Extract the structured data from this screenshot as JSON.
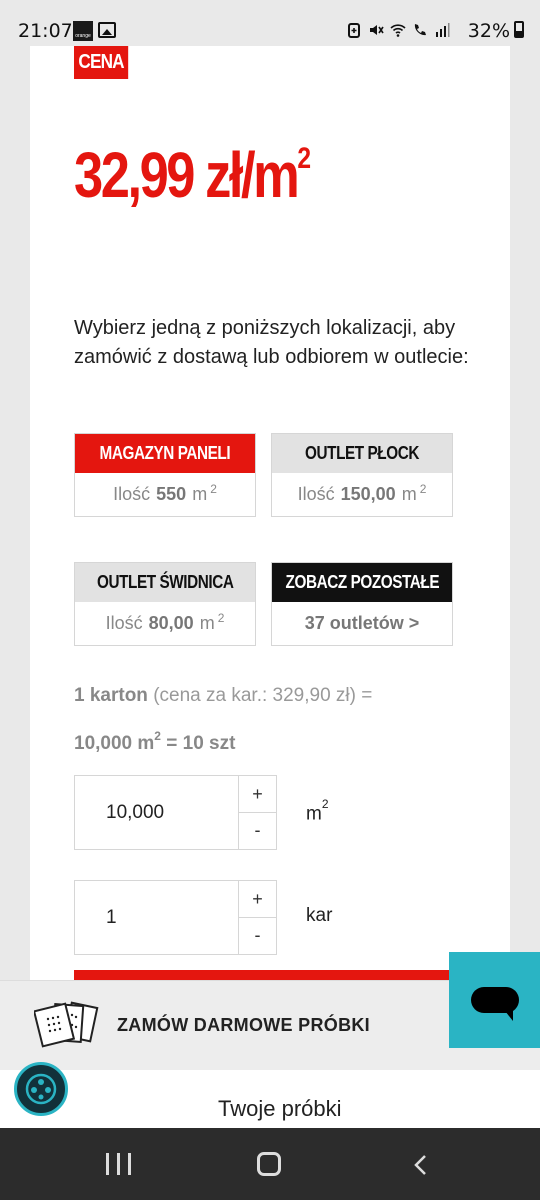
{
  "status_bar": {
    "time": "21:07",
    "carrier_logo": "orange",
    "battery": "32%",
    "icons": [
      "gallery-icon",
      "battery-saver-icon",
      "mute-icon",
      "wifi-icon",
      "wifi-call-icon",
      "signal-icon"
    ]
  },
  "product": {
    "price_badge": "CENA",
    "price": "32,99 zł/m",
    "price_sup": "2"
  },
  "location_intro": "Wybierz jedną z poniższych lokalizacji, aby zamówić z dostawą lub odbiorem w outlecie:",
  "locations": [
    {
      "name": "MAGAZYN PANELI",
      "qty_label": "Ilość",
      "qty": "550",
      "unit": "m",
      "unit_sup": "2",
      "selected": true
    },
    {
      "name": "OUTLET PŁOCK",
      "qty_label": "Ilość",
      "qty": "150,00",
      "unit": "m",
      "unit_sup": "2",
      "selected": false
    },
    {
      "name": "OUTLET ŚWIDNICA",
      "qty_label": "Ilość",
      "qty": "80,00",
      "unit": "m",
      "unit_sup": "2",
      "selected": false
    },
    {
      "name": "ZOBACZ POZOSTAŁE",
      "link": "37 outletów >"
    }
  ],
  "karton": {
    "count": "1 karton",
    "price_note": " (cena za kar.: 329,90 zł) =",
    "area": "10,000 m",
    "area_sup": "2",
    "pieces": " = 10 szt"
  },
  "quantity_m2": {
    "value": "10,000",
    "plus": "+",
    "minus": "-",
    "unit": "m",
    "unit_sup": "2"
  },
  "quantity_kar": {
    "value": "1",
    "plus": "+",
    "minus": "-",
    "unit": "kar"
  },
  "samples_banner": {
    "label": "ZAMÓW DARMOWE PRÓBKI"
  },
  "your_samples": {
    "label": "Twoje próbki"
  },
  "colors": {
    "accent": "#e4160f",
    "chat": "#2ab4c4",
    "dark": "#111111"
  }
}
